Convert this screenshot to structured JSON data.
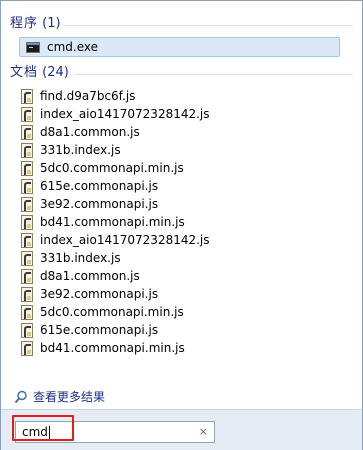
{
  "programs": {
    "header_name": "程序",
    "header_count": "(1)",
    "items": [
      {
        "label": "cmd.exe",
        "icon": "cmd-icon"
      }
    ]
  },
  "documents": {
    "header_name": "文档",
    "header_count": "(24)",
    "items": [
      "find.d9a7bc6f.js",
      "index_aio1417072328142.js",
      "d8a1.common.js",
      "331b.index.js",
      "5dc0.commonapi.min.js",
      "615e.commonapi.js",
      "3e92.commonapi.js",
      "bd41.commonapi.min.js",
      "index_aio1417072328142.js",
      "331b.index.js",
      "d8a1.common.js",
      "3e92.commonapi.js",
      "5dc0.commonapi.min.js",
      "615e.commonapi.js",
      "bd41.commonapi.min.js"
    ]
  },
  "see_more": {
    "label": "查看更多结果",
    "icon": "magnifier-icon"
  },
  "search": {
    "value": "cmd",
    "clear_symbol": "×"
  },
  "colors": {
    "header_text": "#1e3287",
    "selection_bg": "#dbe8f6",
    "highlight_border": "#e0201c"
  }
}
